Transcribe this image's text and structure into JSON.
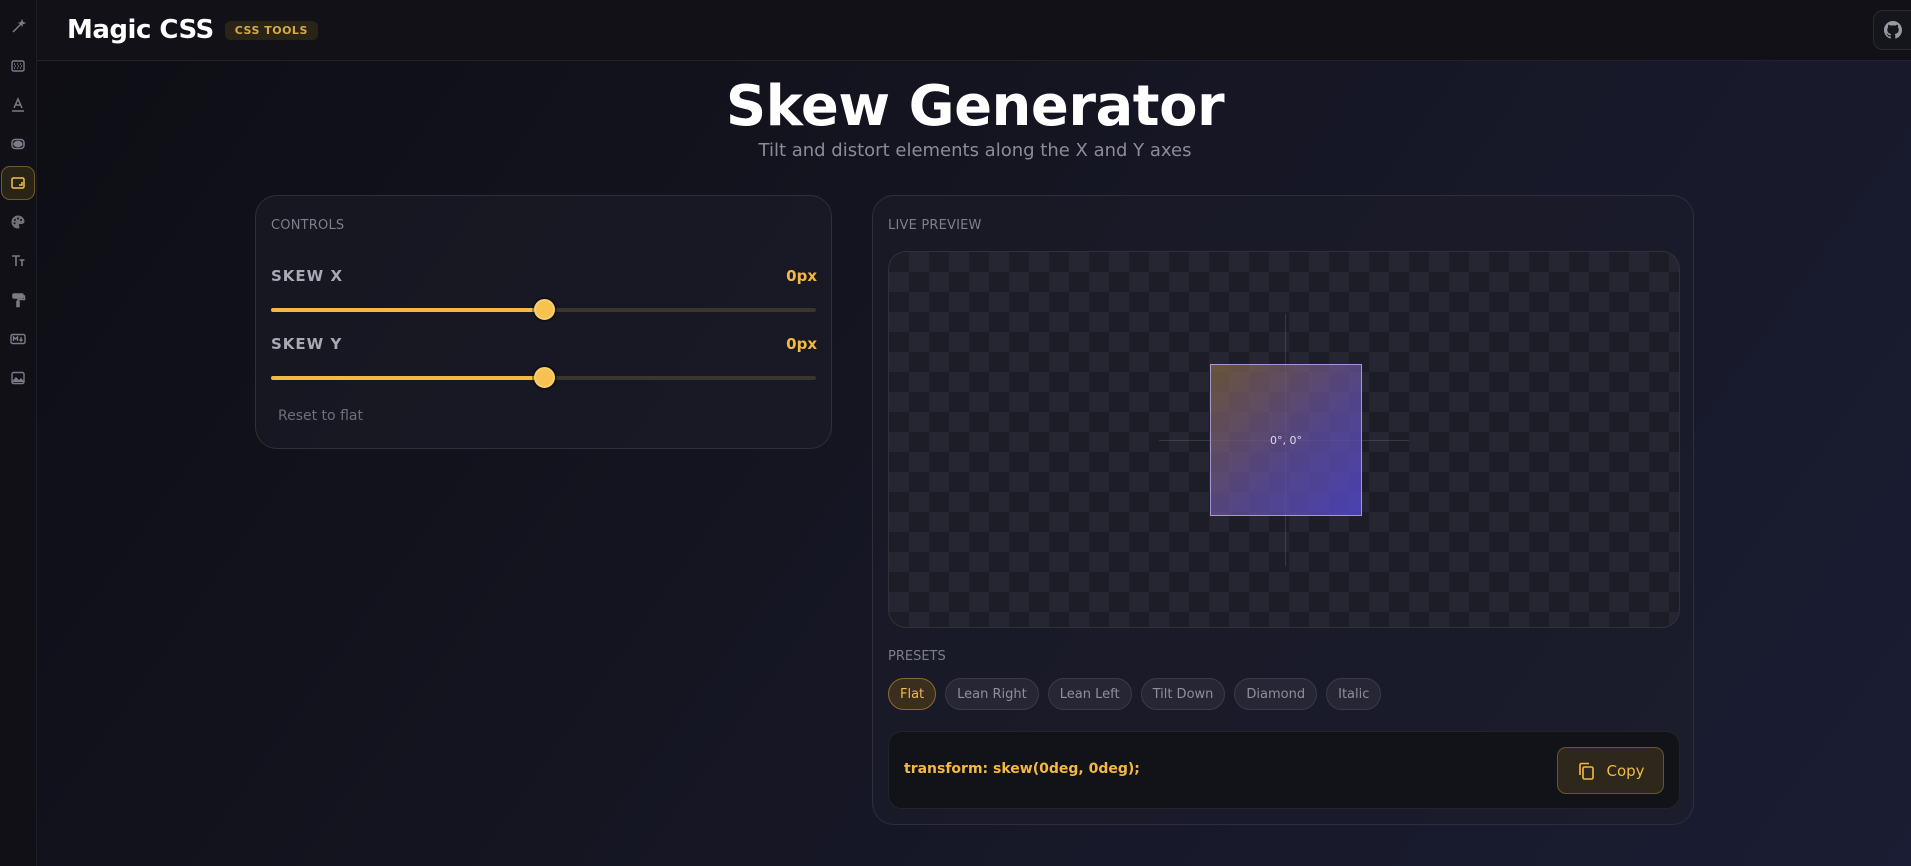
{
  "app": {
    "brand": "Magic CSS",
    "tag": "CSS TOOLS"
  },
  "rail": {
    "icons": [
      "wand-icon",
      "gradient-icon",
      "text-format-icon",
      "shape-icon",
      "skew-icon",
      "palette-icon",
      "font-size-icon",
      "paint-roller-icon",
      "markdown-icon",
      "image-icon"
    ],
    "active_index": 4
  },
  "hero": {
    "title": "Skew Generator",
    "subtitle": "Tilt and distort elements along the X and Y axes"
  },
  "controls": {
    "heading": "CONTROLS",
    "skew_x": {
      "label": "SKEW X",
      "value": "0px",
      "fraction": 0.5
    },
    "skew_y": {
      "label": "SKEW Y",
      "value": "0px",
      "fraction": 0.5
    },
    "reset_label": "Reset to flat"
  },
  "preview": {
    "heading": "LIVE PREVIEW",
    "readout": "0°, 0°"
  },
  "presets": {
    "heading": "PRESETS",
    "items": [
      "Flat",
      "Lean Right",
      "Lean Left",
      "Tilt Down",
      "Diamond",
      "Italic"
    ],
    "active": "Flat"
  },
  "code": {
    "text": "transform: skew(0deg, 0deg);",
    "copy_label": "Copy"
  },
  "colors": {
    "accent": "#f5b942",
    "background": "#151522"
  }
}
